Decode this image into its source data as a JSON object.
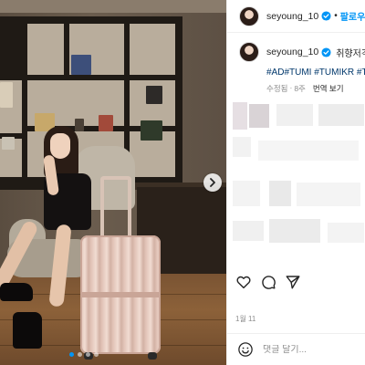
{
  "post": {
    "username": "seyoung_10",
    "verified_icon": "verified-badge-icon",
    "separator": "•",
    "follow_label": "팔로우",
    "caption_text": "취향저격",
    "hashtags": "#AD#TUMI #TUMIKR #TU",
    "edited_label": "수정됨",
    "age": "8주",
    "translate_label": "번역 보기",
    "date": "1월 11",
    "comment_placeholder": "댓글 달기...",
    "carousel": {
      "count": 4,
      "active_index": 0
    }
  },
  "colors": {
    "accent": "#0095f6",
    "hashtag": "#00376b",
    "muted": "#8e8e8e",
    "text": "#262626"
  },
  "icons": {
    "like": "heart-icon",
    "comment": "comment-icon",
    "share": "send-icon",
    "emoji": "emoji-icon",
    "next": "chevron-right-icon"
  }
}
